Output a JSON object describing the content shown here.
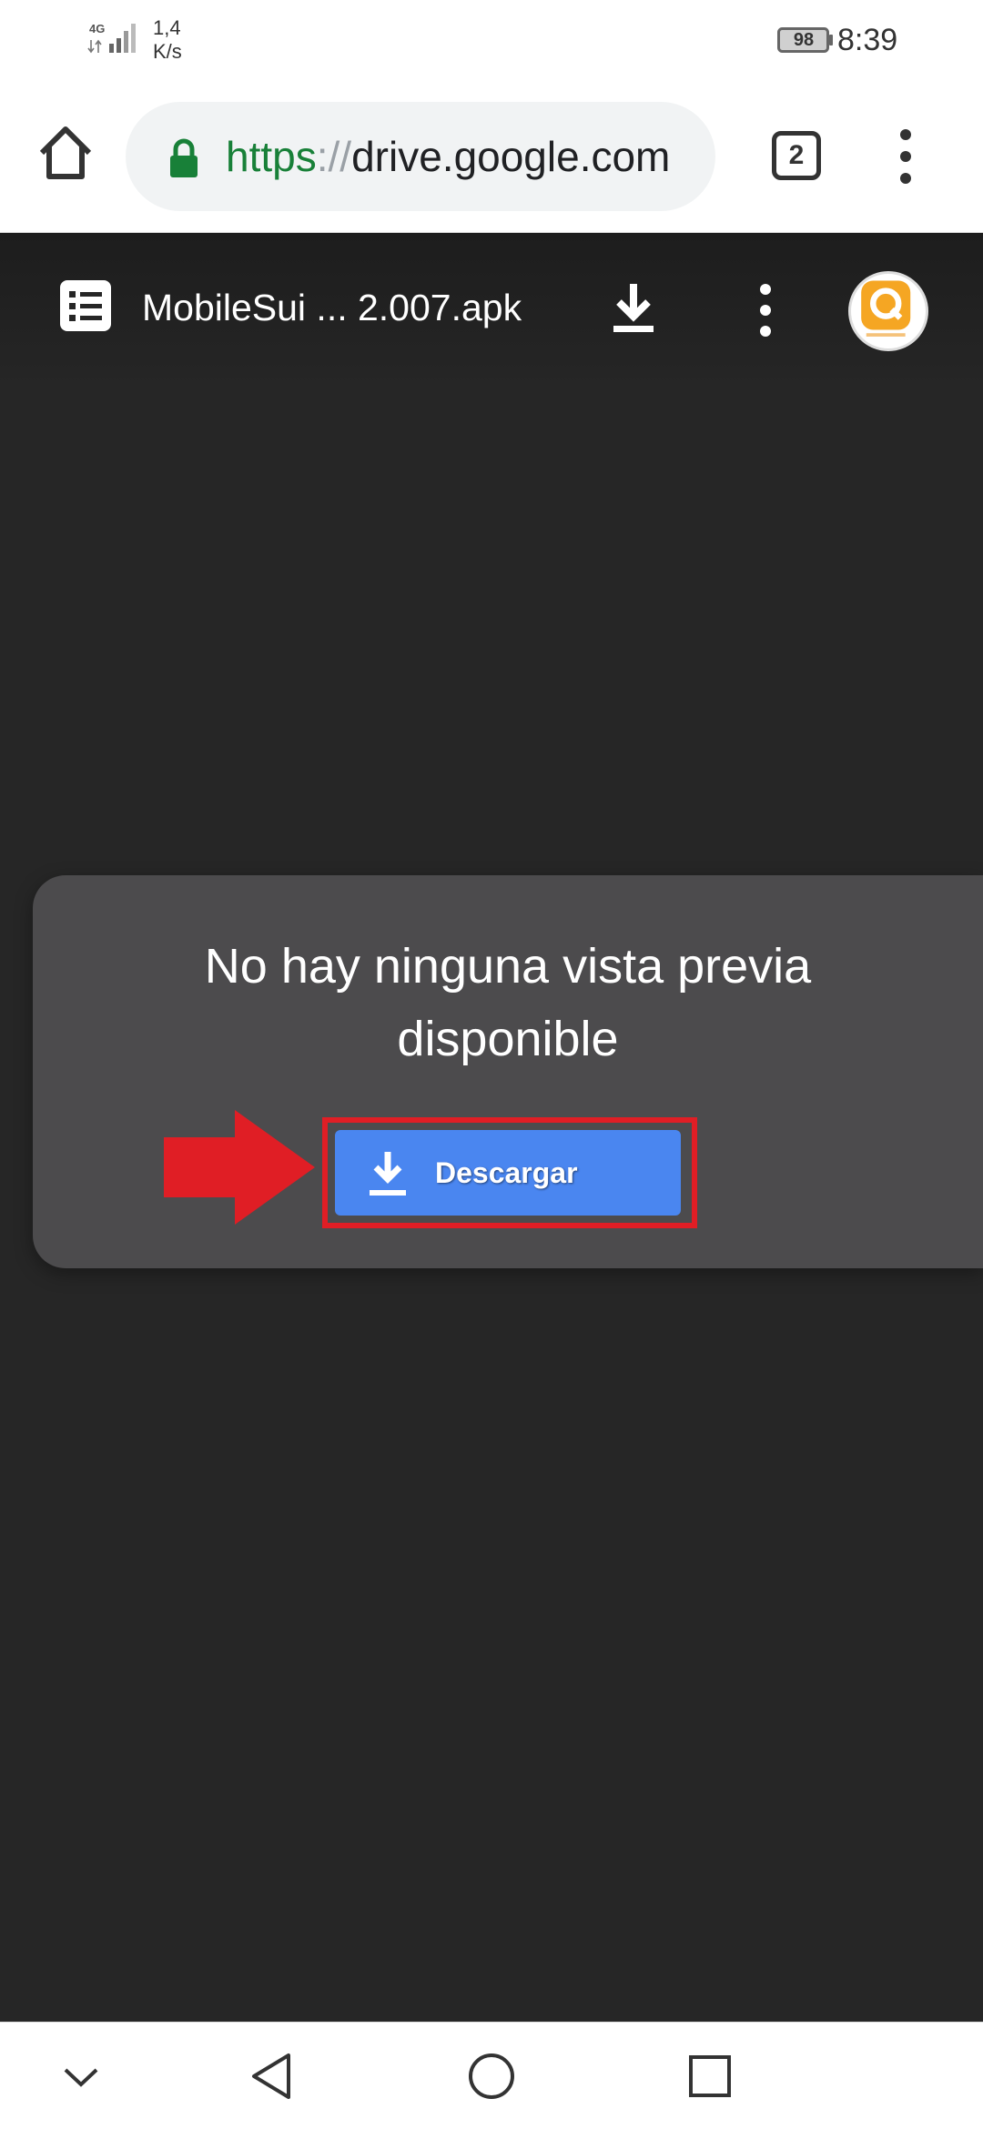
{
  "status_bar": {
    "network_type": "4G",
    "speed_value": "1,4",
    "speed_unit": "K/s",
    "battery_level": "98",
    "time": "8:39"
  },
  "browser": {
    "url_scheme": "https",
    "url_separator": "://",
    "url_host": "drive.google.com",
    "open_tabs_count": "2",
    "icons": {
      "home": "home-icon",
      "lock": "lock-icon",
      "menu": "more-vert-icon"
    }
  },
  "viewer": {
    "file_name": "MobileSui ... 2.007.apk",
    "icons": {
      "file_type": "document-list-icon",
      "download": "download-icon",
      "more": "more-vert-icon",
      "avatar": "account-avatar"
    }
  },
  "preview": {
    "message_line1": "No hay ninguna vista previa",
    "message_line2": "disponible",
    "download_label": "Descargar"
  },
  "annotation": {
    "arrow_color": "#e01e25",
    "highlight_color": "#e01e25"
  },
  "nav_bar": {
    "icons": [
      "chevron-down-icon",
      "back-icon",
      "home-circle-icon",
      "recents-square-icon"
    ]
  },
  "colors": {
    "viewer_bg": "#262626",
    "card_bg": "#4c4b4d",
    "button_blue": "#4a86f0",
    "secure_green": "#188038",
    "avatar_orange": "#f5a623"
  }
}
